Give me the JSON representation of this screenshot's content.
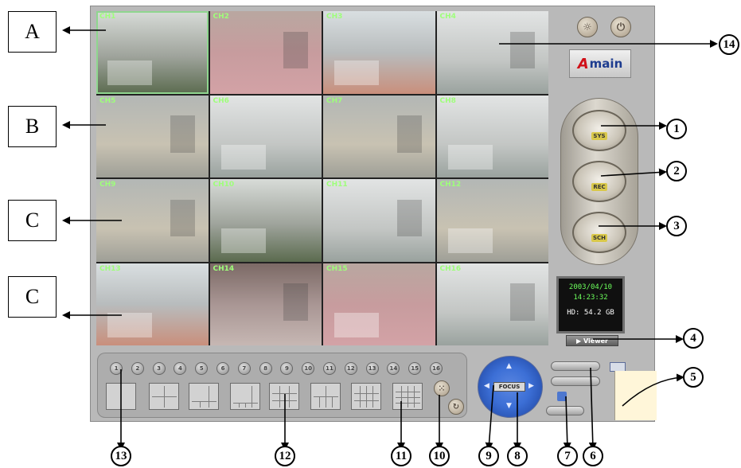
{
  "cameras": [
    {
      "label": "CH1"
    },
    {
      "label": "CH2"
    },
    {
      "label": "CH3"
    },
    {
      "label": "CH4"
    },
    {
      "label": "CH5"
    },
    {
      "label": "CH6"
    },
    {
      "label": "CH7"
    },
    {
      "label": "CH8"
    },
    {
      "label": "CH9"
    },
    {
      "label": "CH10"
    },
    {
      "label": "CH11"
    },
    {
      "label": "CH12"
    },
    {
      "label": "CH13"
    },
    {
      "label": "CH14"
    },
    {
      "label": "CH15"
    },
    {
      "label": "CH16"
    }
  ],
  "right_panel": {
    "logo_mark": "A",
    "logo_text": "main",
    "mode_buttons": [
      {
        "tag": "SYS",
        "icon": "system-icon"
      },
      {
        "tag": "REC",
        "icon": "record-icon"
      },
      {
        "tag": "SCH",
        "icon": "schedule-icon"
      }
    ],
    "display": {
      "date": "2003/04/10",
      "time": "14:23:32",
      "hdd": "HD: 54.2 GB"
    },
    "viewer_label": "▶ Viewer"
  },
  "channels": [
    "1",
    "2",
    "3",
    "4",
    "5",
    "6",
    "7",
    "8",
    "9",
    "10",
    "11",
    "12",
    "13",
    "14",
    "15",
    "16"
  ],
  "ptz": {
    "focus_label": "FOCUS"
  },
  "callouts": {
    "boxes": [
      "A",
      "B",
      "C",
      "C"
    ],
    "numbers": [
      "1",
      "2",
      "3",
      "4",
      "5",
      "6",
      "7",
      "8",
      "9",
      "10",
      "11",
      "12",
      "13",
      "14"
    ]
  },
  "colors": {
    "accent_green": "#8fd68f",
    "ptz_blue": "#3c6fd6",
    "logo_red": "#d01018"
  }
}
